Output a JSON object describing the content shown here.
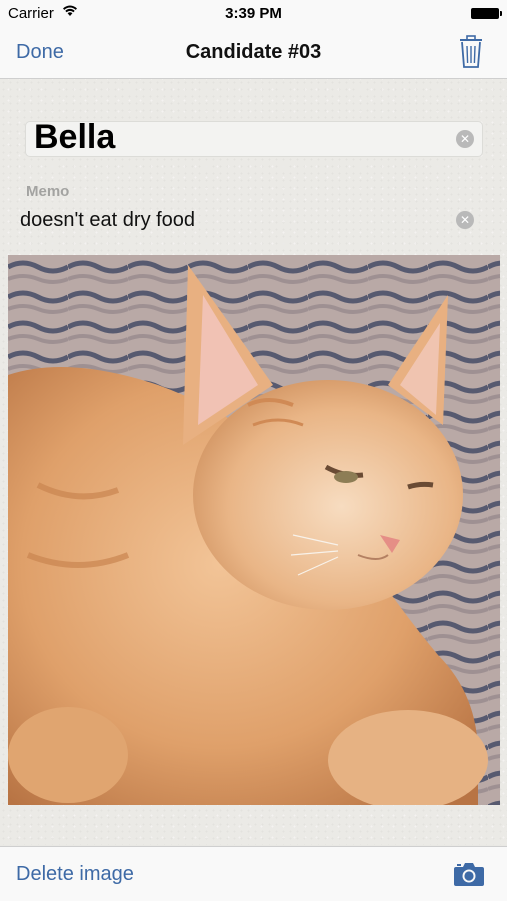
{
  "status_bar": {
    "carrier": "Carrier",
    "time": "3:39 PM"
  },
  "nav": {
    "done_label": "Done",
    "title": "Candidate #03",
    "trash_icon": "trash-icon"
  },
  "form": {
    "name_value": "Bella",
    "memo_label": "Memo",
    "memo_value": "doesn't eat dry food",
    "clear_icon": "clear-icon"
  },
  "photo": {
    "subject": "photo-kitten"
  },
  "toolbar": {
    "delete_label": "Delete image",
    "camera_icon": "camera-icon"
  },
  "colors": {
    "accent": "#3e6aa6",
    "background": "#ebeae6",
    "bar": "#f9f9f9"
  }
}
